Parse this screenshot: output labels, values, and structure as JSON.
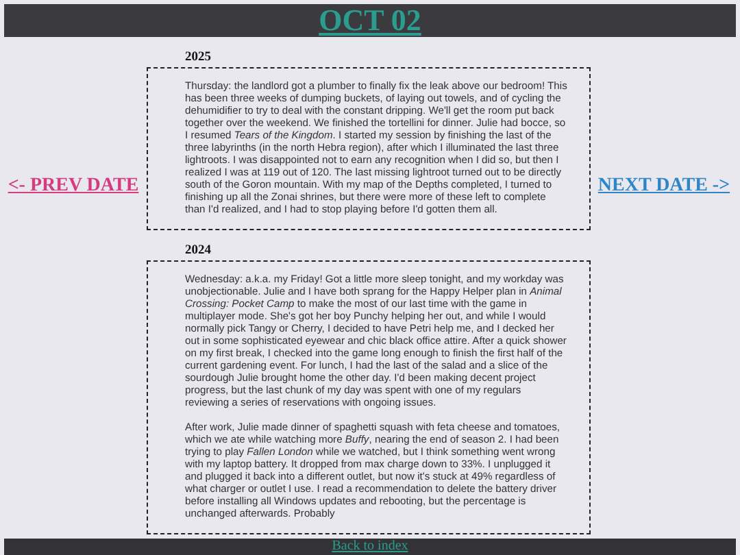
{
  "header": {
    "title": "OCT 02"
  },
  "nav": {
    "prev": "<- PREV DATE",
    "next": "NEXT DATE ->"
  },
  "entries": [
    {
      "year": "2025",
      "paragraphs": [
        "Thursday: the landlord got a plumber to finally fix the leak above our bedroom! This has been three weeks of dumping buckets, of laying out towels, and of cycling the dehumidifier to try to deal with the constant dripping. We'll get the room put back together over the weekend. We finished the tortellini for dinner. Julie had bocce, so I resumed *Tears of the Kingdom*. I started my session by finishing the last of the three labyrinths (in the north Hebra region), after which I illuminated the last three lightroots. I was disappointed not to earn any recognition when I did so, but then I realized I was at 119 out of 120. The last missing lightroot turned out to be directly south of the Goron mountain. With my map of the Depths completed, I turned to finishing up all the Zonai shrines, but there were more of these left to complete than I'd realized, and I had to stop playing before I'd gotten them all."
      ]
    },
    {
      "year": "2024",
      "paragraphs": [
        "Wednesday: a.k.a. my Friday! Got a little more sleep tonight, and my workday was unobjectionable. Julie and I have both sprang for the Happy Helper plan in *Animal Crossing: Pocket Camp* to make the most of our last time with the game in multiplayer mode. She's got her boy Punchy helping her out, and while I would normally pick Tangy or Cherry, I decided to have Petri help me, and I decked her out in some sophisticated eyewear and chic black office attire. After a quick shower on my first break, I checked into the game long enough to finish the first half of the current gardening event. For lunch, I had the last of the salad and a slice of the sourdough Julie brought home the other day. I'd been making decent project progress, but the last chunk of my day was spent with one of my regulars reviewing a series of reservations with ongoing issues.",
        "After work, Julie made dinner of spaghetti squash with feta cheese and tomatoes, which we ate while watching more *Buffy*, nearing the end of season 2. I had been trying to play *Fallen London* while we watched, but I think something went wrong with my laptop battery. It dropped from max charge down to 33%. I unplugged it and plugged it back into a different outlet, but now it's stuck at 49% regardless of what charger or outlet I use. I read a recommendation to delete the battery driver before installing all Windows updates and rebooting, but the percentage is unchanged afterwards. Probably"
      ]
    }
  ],
  "footer": {
    "link": "Back to index"
  }
}
